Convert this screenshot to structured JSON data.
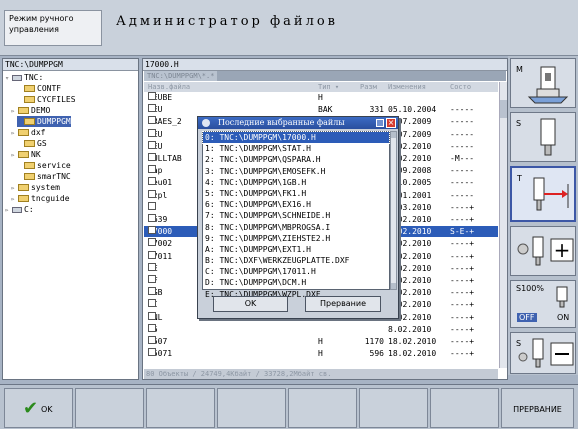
{
  "header": {
    "mode": "Режим ручного\nуправления",
    "title": "Администратор файлов"
  },
  "tree": {
    "path": "TNC:\\DUMPPGM",
    "items": [
      {
        "label": "TNC:",
        "icon": "drive",
        "ex": "▿"
      },
      {
        "label": "CONTF",
        "icon": "folder",
        "ex": ""
      },
      {
        "label": "CYCFILES",
        "icon": "folder",
        "ex": ""
      },
      {
        "label": "DEMO",
        "icon": "folder",
        "ex": "▹"
      },
      {
        "label": "DUMPPGM",
        "icon": "folder",
        "ex": ""
      },
      {
        "label": "dxf",
        "icon": "folder",
        "ex": "▹"
      },
      {
        "label": "GS",
        "icon": "folder",
        "ex": ""
      },
      {
        "label": "NK",
        "icon": "folder",
        "ex": "▹"
      },
      {
        "label": "service",
        "icon": "folder",
        "ex": ""
      },
      {
        "label": "smarTNC",
        "icon": "folder",
        "ex": ""
      },
      {
        "label": "system",
        "icon": "folder",
        "ex": "▹"
      },
      {
        "label": "tncguide",
        "icon": "folder",
        "ex": "▹"
      },
      {
        "label": "C:",
        "icon": "drive",
        "ex": "▹"
      }
    ]
  },
  "files": {
    "path": "17000.H",
    "tab": "TNC:\\DUMPPGM\\*.*",
    "headers": {
      "name": "Назв.файла",
      "type": "Тип ▾",
      "size": "Разм",
      "date": "Изменения",
      "status": "Состо"
    },
    "rows": [
      {
        "name": "NEUBE",
        "type": "H",
        "size": "",
        "date": "",
        "status": ""
      },
      {
        "name": "NEU",
        "type": "BAK",
        "size": "331",
        "date": "05.10.2004",
        "status": "-----"
      },
      {
        "name": "FRAES_2",
        "type": "",
        "size": "",
        "date": "1.07.2009",
        "status": "-----"
      },
      {
        "name": "NEU",
        "type": "",
        "size": "",
        "date": "1.07.2009",
        "status": "-----"
      },
      {
        "name": "NEU",
        "type": "",
        "size": "",
        "date": "8.02.2010",
        "status": "-----"
      },
      {
        "name": "NULLTAB",
        "type": "",
        "size": "",
        "date": "8.02.2010",
        "status": "-M---"
      },
      {
        "name": "cap",
        "type": "",
        "size": "",
        "date": "9.09.2008",
        "status": "-----"
      },
      {
        "name": "deu01",
        "type": "",
        "size": "",
        "date": "0.10.2005",
        "status": "-----"
      },
      {
        "name": "wzpl",
        "type": "",
        "size": "",
        "date": "8.01.2001",
        "status": "-----"
      },
      {
        "name": "1",
        "type": "",
        "size": "",
        "date": "3.03.2010",
        "status": "----+"
      },
      {
        "name": "1639",
        "type": "",
        "size": "",
        "date": "8.02.2010",
        "status": "----+"
      },
      {
        "name": "17000",
        "type": "",
        "size": "",
        "date": "8.02.2010",
        "status": "S-E-+"
      },
      {
        "name": "17002",
        "type": "",
        "size": "",
        "date": "8.02.2010",
        "status": "----+"
      },
      {
        "name": "17011",
        "type": "",
        "size": "",
        "date": "8.02.2010",
        "status": "----+"
      },
      {
        "name": "1E",
        "type": "",
        "size": "",
        "date": "8.02.2010",
        "status": "----+"
      },
      {
        "name": "1F",
        "type": "",
        "size": "",
        "date": "8.02.2010",
        "status": "----+"
      },
      {
        "name": "1GB",
        "type": "",
        "size": "",
        "date": "8.02.2010",
        "status": "----+"
      },
      {
        "name": "1I",
        "type": "",
        "size": "",
        "date": "8.02.2010",
        "status": "----+"
      },
      {
        "name": "1NL",
        "type": "",
        "size": "",
        "date": "8.02.2010",
        "status": "----+"
      },
      {
        "name": "15",
        "type": "",
        "size": "",
        "date": "8.02.2010",
        "status": "----+"
      },
      {
        "name": "3507",
        "type": "H",
        "size": "1170",
        "date": "18.02.2010",
        "status": "----+"
      },
      {
        "name": "35071",
        "type": "H",
        "size": "596",
        "date": "18.02.2010",
        "status": "----+"
      }
    ],
    "status": "80 Объекты / 24749,4Кбайт / 33728,2Мбайт св."
  },
  "dialog": {
    "title": "Последние выбранные файлы",
    "items": [
      "0: TNC:\\DUMPPGM\\17000.H",
      "1: TNC:\\DUMPPGM\\STAT.H",
      "2: TNC:\\DUMPPGM\\QSPARA.H",
      "3: TNC:\\DUMPPGM\\EMOSEFK.H",
      "4: TNC:\\DUMPPGM\\1GB.H",
      "5: TNC:\\DUMPPGM\\FK1.H",
      "6: TNC:\\DUMPPGM\\EX16.H",
      "7: TNC:\\DUMPPGM\\SCHNEIDE.H",
      "8: TNC:\\DUMPPGM\\MBPROGSA.I",
      "9: TNC:\\DUMPPGM\\ZIEHSTE2.H",
      "A: TNC:\\DUMPPGM\\EXT1.H",
      "B: TNC:\\DXF\\WERKZEUGPLATTE.DXF",
      "C: TNC:\\DUMPPGM\\17011.H",
      "D: TNC:\\DUMPPGM\\DCM.H",
      "E: TNC:\\DUMPPGM\\WZPL.DXF"
    ],
    "ok": "OK",
    "cancel": "Прервание"
  },
  "side": {
    "m": "M",
    "s": "S",
    "t": "T",
    "s100": "S100%",
    "off": "OFF",
    "on": "ON",
    "plus": "+",
    "minus": "−"
  },
  "bottom": {
    "ok": "OK",
    "cancel": "ПРЕРВАНИЕ"
  },
  "colors": {
    "selection": "#2c5cb8",
    "ok_check": "#2b8a1c",
    "close": "#d63b2e"
  }
}
